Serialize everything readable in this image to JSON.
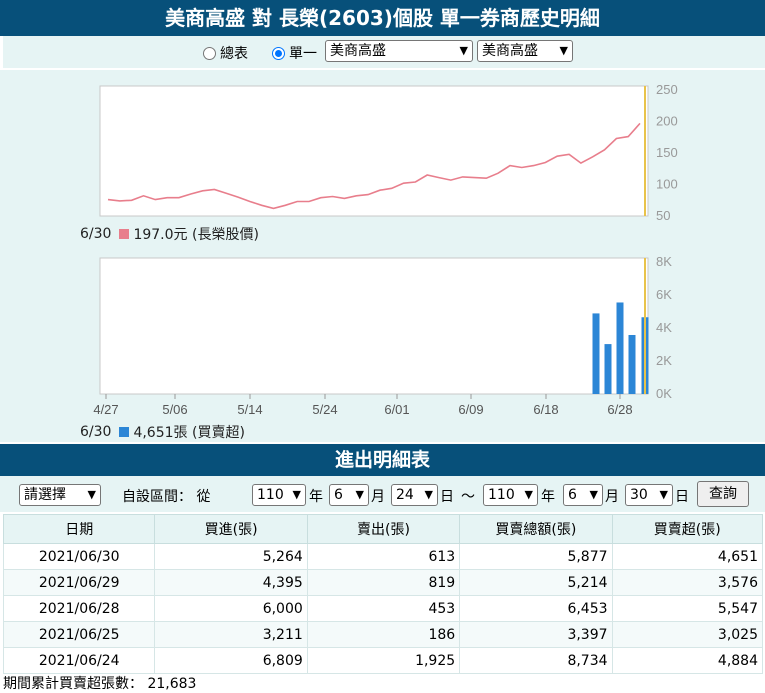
{
  "header": {
    "title": "美商高盛 對 長榮(2603)個股 單一券商歷史明細"
  },
  "controls": {
    "radio_total": "總表",
    "radio_single": "單一",
    "broker_select": "美商高盛",
    "branch_select": "美商高盛"
  },
  "price_chart": {
    "y_ticks": [
      "250",
      "200",
      "150",
      "100",
      "50"
    ],
    "legend_date": "6/30",
    "legend_text": "197.0元 (長榮股價)",
    "color": "#e87e8c"
  },
  "volume_chart": {
    "y_ticks": [
      "8K",
      "6K",
      "4K",
      "2K",
      "0K"
    ],
    "x_ticks": [
      "4/27",
      "5/06",
      "5/14",
      "5/24",
      "6/01",
      "6/09",
      "6/18",
      "6/28"
    ],
    "legend_date": "6/30",
    "legend_text": "4,651張 (買賣超)",
    "color": "#2c86d6"
  },
  "chart_data": [
    {
      "type": "line",
      "title": "",
      "ylim": [
        50,
        250
      ],
      "x_ticks": [
        "4/27",
        "5/06",
        "5/14",
        "5/24",
        "6/01",
        "6/09",
        "6/18",
        "6/28"
      ],
      "series": [
        {
          "name": "長榮股價",
          "values": [
            76,
            74,
            75,
            82,
            76,
            79,
            79,
            85,
            90,
            92,
            86,
            80,
            73,
            67,
            62,
            67,
            73,
            73,
            79,
            81,
            78,
            82,
            84,
            91,
            94,
            102,
            104,
            115,
            111,
            107,
            112,
            111,
            110,
            118,
            130,
            127,
            130,
            135,
            145,
            148,
            134,
            144,
            155,
            173,
            176,
            197
          ]
        }
      ],
      "last_value": 197.0
    },
    {
      "type": "bar",
      "title": "",
      "ylim": [
        0,
        8000
      ],
      "x_ticks": [
        "4/27",
        "5/06",
        "5/14",
        "5/24",
        "6/01",
        "6/09",
        "6/18",
        "6/28"
      ],
      "series": [
        {
          "name": "買賣超",
          "values": [
            4884,
            3025,
            5547,
            3576,
            4651
          ]
        }
      ],
      "last_value": 4651
    }
  ],
  "section_title": "進出明細表",
  "filter": {
    "preset": "請選擇",
    "label": "自設區間： 從",
    "from_year": "110",
    "from_month": "6",
    "from_day": "24",
    "to_year": "110",
    "to_month": "6",
    "to_day": "30",
    "unit_year": "年",
    "unit_month": "月",
    "unit_day": "日",
    "tilde": "～",
    "query_button": "查詢"
  },
  "table": {
    "headers": [
      "日期",
      "買進(張)",
      "賣出(張)",
      "買賣總額(張)",
      "買賣超(張)"
    ],
    "rows": [
      [
        "2021/06/30",
        "5,264",
        "613",
        "5,877",
        "4,651"
      ],
      [
        "2021/06/29",
        "4,395",
        "819",
        "5,214",
        "3,576"
      ],
      [
        "2021/06/28",
        "6,000",
        "453",
        "6,453",
        "5,547"
      ],
      [
        "2021/06/25",
        "3,211",
        "186",
        "3,397",
        "3,025"
      ],
      [
        "2021/06/24",
        "6,809",
        "1,925",
        "8,734",
        "4,884"
      ]
    ]
  },
  "footer": {
    "label": "期間累計買賣超張數：",
    "value": "21,683"
  }
}
